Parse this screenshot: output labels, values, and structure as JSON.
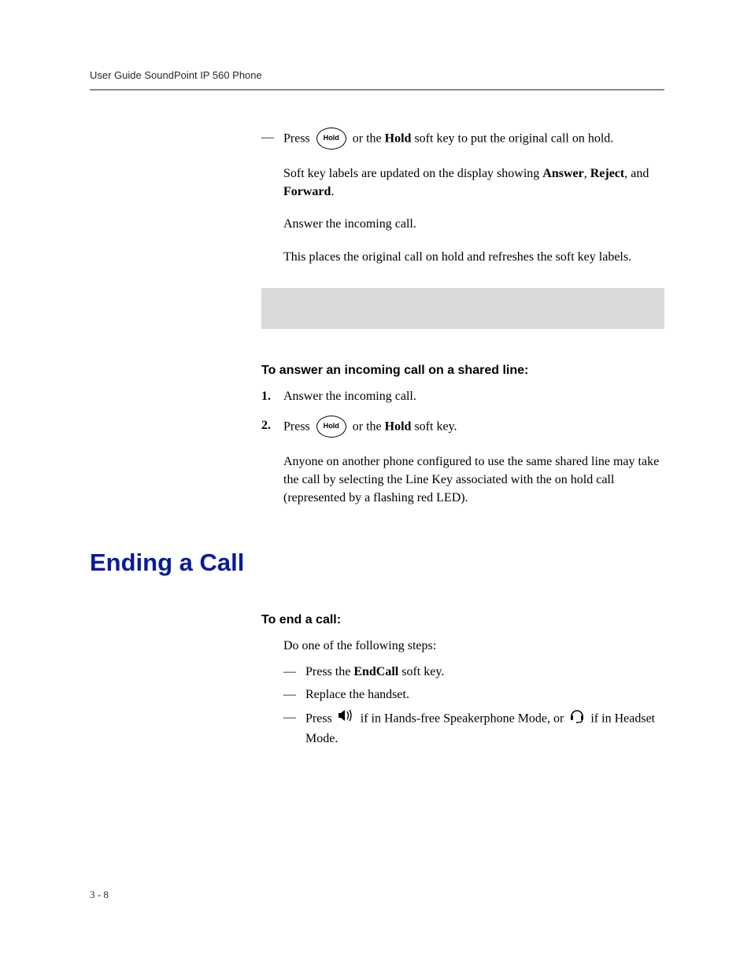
{
  "header": {
    "running_head": "User Guide SoundPoint IP 560 Phone"
  },
  "section1": {
    "bullet1_pre": "Press ",
    "hold_label": "Hold",
    "bullet1_mid": " or the ",
    "bullet1_bold": "Hold",
    "bullet1_post": " soft key to put the original call on hold.",
    "p1a": "Soft key labels are updated on the display showing ",
    "p1b1": "Answer",
    "p1c": ", ",
    "p1b2": "Reject",
    "p1d": ", and ",
    "p1b3": "Forward",
    "p1e": ".",
    "p2": "Answer the incoming call.",
    "p3": "This places the original call on hold and refreshes the soft key labels."
  },
  "section2": {
    "heading": "To answer an incoming call on a shared line:",
    "step1_num": "1.",
    "step1": "Answer the incoming call.",
    "step2_num": "2.",
    "step2_pre": "Press ",
    "hold_label": "Hold",
    "step2_mid": " or the ",
    "step2_bold": "Hold",
    "step2_post": " soft key.",
    "p1": "Anyone on another phone configured to use the same shared line may take the call by selecting the Line Key associated with the on hold call (represented by a flashing red LED)."
  },
  "section3": {
    "title": "Ending a Call",
    "heading": "To end a call:",
    "intro": "Do one of the following steps:",
    "b1_pre": "Press the ",
    "b1_bold": "EndCall",
    "b1_post": " soft key.",
    "b2": "Replace the handset.",
    "b3_pre": "Press ",
    "b3_mid": " if in Hands-free Speakerphone Mode, or ",
    "b3_post": " if in Headset Mode."
  },
  "footer": {
    "page": "3 - 8"
  }
}
